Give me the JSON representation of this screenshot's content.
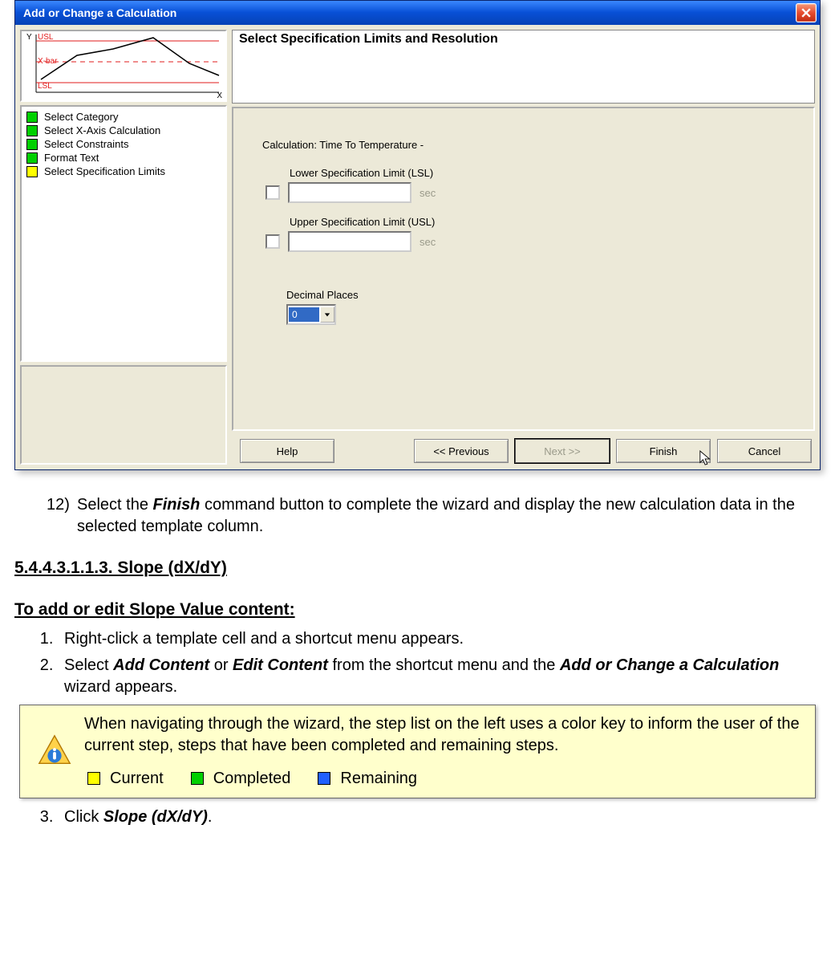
{
  "dialog": {
    "title": "Add or Change a Calculation",
    "graphic": {
      "y": "Y",
      "usl": "USL",
      "xbar": "X-bar",
      "lsl": "LSL",
      "x": "X"
    },
    "steps": [
      {
        "color": "green",
        "label": "Select Category"
      },
      {
        "color": "green",
        "label": "Select X-Axis Calculation"
      },
      {
        "color": "green",
        "label": "Select Constraints"
      },
      {
        "color": "green",
        "label": "Format Text"
      },
      {
        "color": "yellow",
        "label": "Select Specification Limits"
      }
    ],
    "header": "Select Specification Limits and Resolution",
    "form": {
      "calculation_label": "Calculation: Time To Temperature -",
      "lsl_label": "Lower Specification Limit (LSL)",
      "usl_label": "Upper Specification Limit (USL)",
      "unit": "sec",
      "decimal_label": "Decimal Places",
      "decimal_value": "0"
    },
    "buttons": {
      "help": "Help",
      "prev": "<< Previous",
      "next": "Next >>",
      "finish": "Finish",
      "cancel": "Cancel"
    }
  },
  "doc": {
    "step12_num": "12)",
    "step12_a": "Select the ",
    "step12_b": "Finish",
    "step12_c": " command button to complete the wizard and display the new calculation data in the selected template column.",
    "section": "5.4.4.3.1.1.3. Slope (dX/dY)",
    "subheading": "To add or edit Slope Value content:",
    "s1": "Right-click a template cell and a shortcut menu appears.",
    "s2_a": "Select ",
    "s2_b": "Add Content",
    "s2_c": " or ",
    "s2_d": "Edit Content",
    "s2_e": " from the shortcut menu and the ",
    "s2_f": "Add or Change a Calculation",
    "s2_g": " wizard appears.",
    "note": "When navigating through the wizard, the step list on the left uses a color key to inform the user of the current step, steps that have been completed and remaining steps.",
    "legend": {
      "current": "Current",
      "completed": "Completed",
      "remaining": "Remaining"
    },
    "s3_a": "Click ",
    "s3_b": "Slope (dX/dY)",
    "s3_c": "."
  }
}
